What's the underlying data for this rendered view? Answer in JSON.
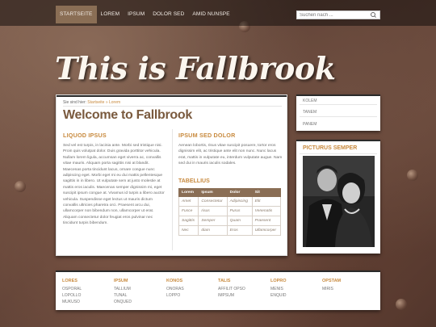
{
  "nav": {
    "items": [
      {
        "label": "STARTSEITE",
        "active": true
      },
      {
        "label": "LOREM",
        "active": false
      },
      {
        "label": "IPSUM",
        "active": false
      },
      {
        "label": "DOLOR SED",
        "active": false
      },
      {
        "label": "AMID NUNSPE",
        "active": false
      }
    ],
    "active_color": "#8a6e55"
  },
  "search": {
    "placeholder": "Suchen nach ...",
    "icon": "magnifier-icon"
  },
  "site": {
    "title": "This is Fallbrook"
  },
  "breadcrumb": {
    "prefix": "Sie sind hier:",
    "link": "Startseite",
    "sep": "»",
    "current": "Lorem"
  },
  "page": {
    "title": "Welcome to Fallbrook"
  },
  "left_col": {
    "heading": "LIQUOD IPSUS",
    "text": "Sed vel est turpis, in lacinia ante. Morbi sed tristique nisi. Proin quis volutpat dolor. Duis gravida porttitor vehicula. Nullam lorem ligula, accumsan eget viverra ac, convallis vitae mauris. Aliquam porta sagittis nisi at blandit. Maecenas porta tincidunt lacus, ornare congue nunc adipiscing eget. Morbi eget mi eu dui mattis pellentesque sagittis in in libero. Ut vulputate sem at justo molestie at mattis eros iaculis. Maecenas semper dignissim mi, eget suscipit ipsum congue at. Vivamus id turpis a libero auctor vehicula. Suspendisse eget lectus ut mauris dictum convallis ultricies pharetra orci. Praesent arcu dui, ullamcorper non bibendum non, ullamcorper ut erat. Aliquam consectetur dolor feugiat eros pulvinar nec tincidunt turpis bibendum."
  },
  "right_col": {
    "heading": "IPSUM SED DOLOR",
    "text": "Aenean lobortis, risus vitae suscipit posuere, tortor eros dignissim elit, ac tristique ante elit non nunc. Nunc lacus erat, mattis in vulputate eu, interdum vulputate augue. Nam sed dui in mauris iaculis sodales."
  },
  "table": {
    "title": "TABELLIUS",
    "headers": [
      "Lorem",
      "Ipsum",
      "Dolor",
      "Sit"
    ],
    "rows": [
      [
        "Amet",
        "Consectetur",
        "Adipiscing",
        "Elit"
      ],
      [
        "Fusce",
        "risus",
        "Purus",
        "Venenatis"
      ],
      [
        "Sagittis",
        "Semper",
        "Quam",
        "Praesent"
      ],
      [
        "Nec",
        "diam",
        "Eros",
        "Ullamcorper"
      ]
    ]
  },
  "sidebar": {
    "items": [
      "KOLEM",
      "TANEM",
      "PANEM"
    ],
    "pic_title": "PICTURUS SEMPER"
  },
  "footer": {
    "columns": [
      {
        "heading": "LORES",
        "links": [
          "OSPORAL",
          "LOPOLLO",
          "MUKUSO"
        ]
      },
      {
        "heading": "IPSUM",
        "links": [
          "TALLIUM",
          "TUNAL",
          "ONQUED"
        ]
      },
      {
        "heading": "KONOS",
        "links": [
          "ONORAS",
          "LOPPO"
        ]
      },
      {
        "heading": "TALIS",
        "links": [
          "AFFILIT OPSO",
          "IMPSUM"
        ]
      },
      {
        "heading": "LOPRO",
        "links": [
          "MENIS",
          "ENQUID"
        ]
      },
      {
        "heading": "OPSTAM",
        "links": [
          "MIRIS"
        ]
      }
    ]
  },
  "colors": {
    "accent": "#c88a3e",
    "title_brown": "#7a5a3e",
    "nav_active": "#8a6e55"
  }
}
